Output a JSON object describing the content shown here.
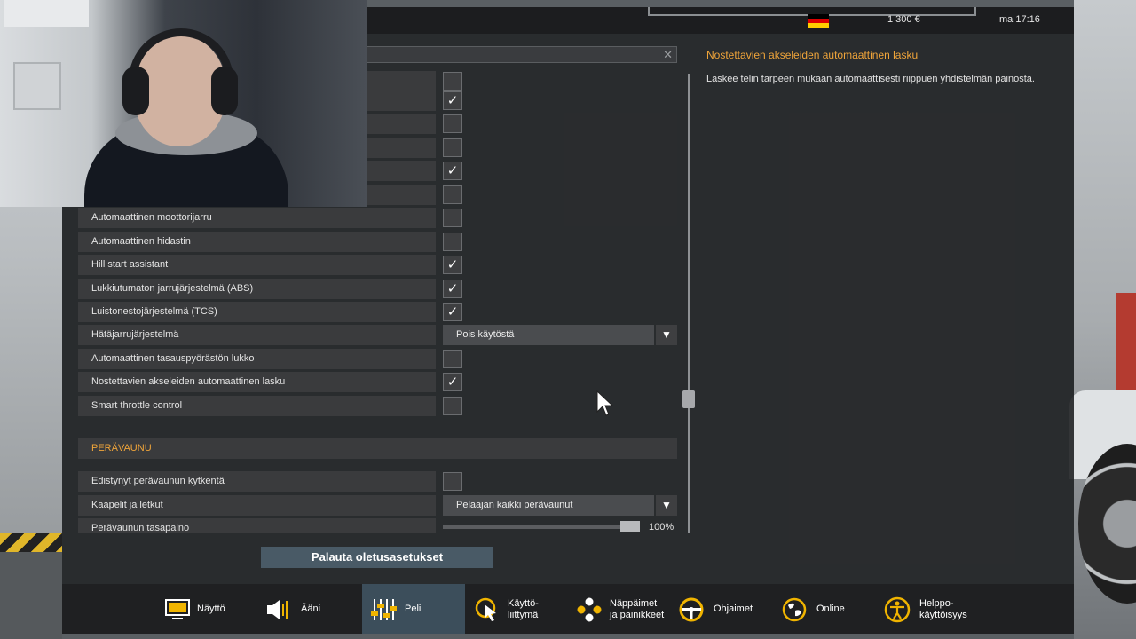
{
  "topbar": {
    "money": "1 300 €",
    "clock": "ma 17:16"
  },
  "colors": {
    "accent": "#f0a53a",
    "active_tab": "#3c4e5b",
    "row_bg": "#3a3b3d"
  },
  "settings": {
    "hidden_rows": [
      {
        "checked": false
      },
      {
        "checked": true
      },
      {
        "checked": false
      },
      {
        "checked": false
      },
      {
        "checked": true
      },
      {
        "checked": false
      }
    ],
    "rows": [
      {
        "label": "Automaattinen moottorijarru",
        "checked": false
      },
      {
        "label": "Automaattinen hidastin",
        "checked": false
      },
      {
        "label": "Hill start assistant",
        "checked": true
      },
      {
        "label": "Lukkiutumaton jarrujärjestelmä (ABS)",
        "checked": true
      },
      {
        "label": "Luistonestojärjestelmä (TCS)",
        "checked": true
      },
      {
        "label": "Hätäjarrujärjestelmä",
        "value": "Pois käytöstä"
      },
      {
        "label": "Automaattinen tasauspyörästön lukko",
        "checked": false
      },
      {
        "label": "Nostettavien akseleiden automaattinen lasku",
        "checked": true
      },
      {
        "label": "Smart throttle control",
        "checked": false
      }
    ],
    "trailer_section": "PERÄVAUNU",
    "trailer_rows": [
      {
        "label": "Edistynyt perävaunun kytkentä",
        "checked": false
      },
      {
        "label": "Kaapelit ja letkut",
        "value": "Pelaajan kaikki perävaunut"
      },
      {
        "label": "Perävaunun tasapaino",
        "percent": "100%",
        "level": 100
      }
    ]
  },
  "info": {
    "title": "Nostettavien akseleiden automaattinen lasku",
    "text": "Laskee telin tarpeen mukaan automaattisesti riippuen yhdistelmän painosta."
  },
  "reset_label": "Palauta oletusasetukset",
  "tabs": [
    {
      "label": "Näyttö",
      "icon": "monitor-icon"
    },
    {
      "label": "Ääni",
      "icon": "speaker-icon"
    },
    {
      "label": "Peli",
      "icon": "sliders-icon",
      "active": true
    },
    {
      "label_line1": "Käyttö-",
      "label_line2": "liittymä",
      "icon": "cursor-icon"
    },
    {
      "label_line1": "Näppäimet",
      "label_line2": "ja painikkeet",
      "icon": "gamepad-buttons-icon"
    },
    {
      "label": "Ohjaimet",
      "icon": "steering-wheel-icon"
    },
    {
      "label": "Online",
      "icon": "globe-icon"
    },
    {
      "label_line1": "Helppo-",
      "label_line2": "käyttöisyys",
      "icon": "accessibility-icon"
    }
  ]
}
